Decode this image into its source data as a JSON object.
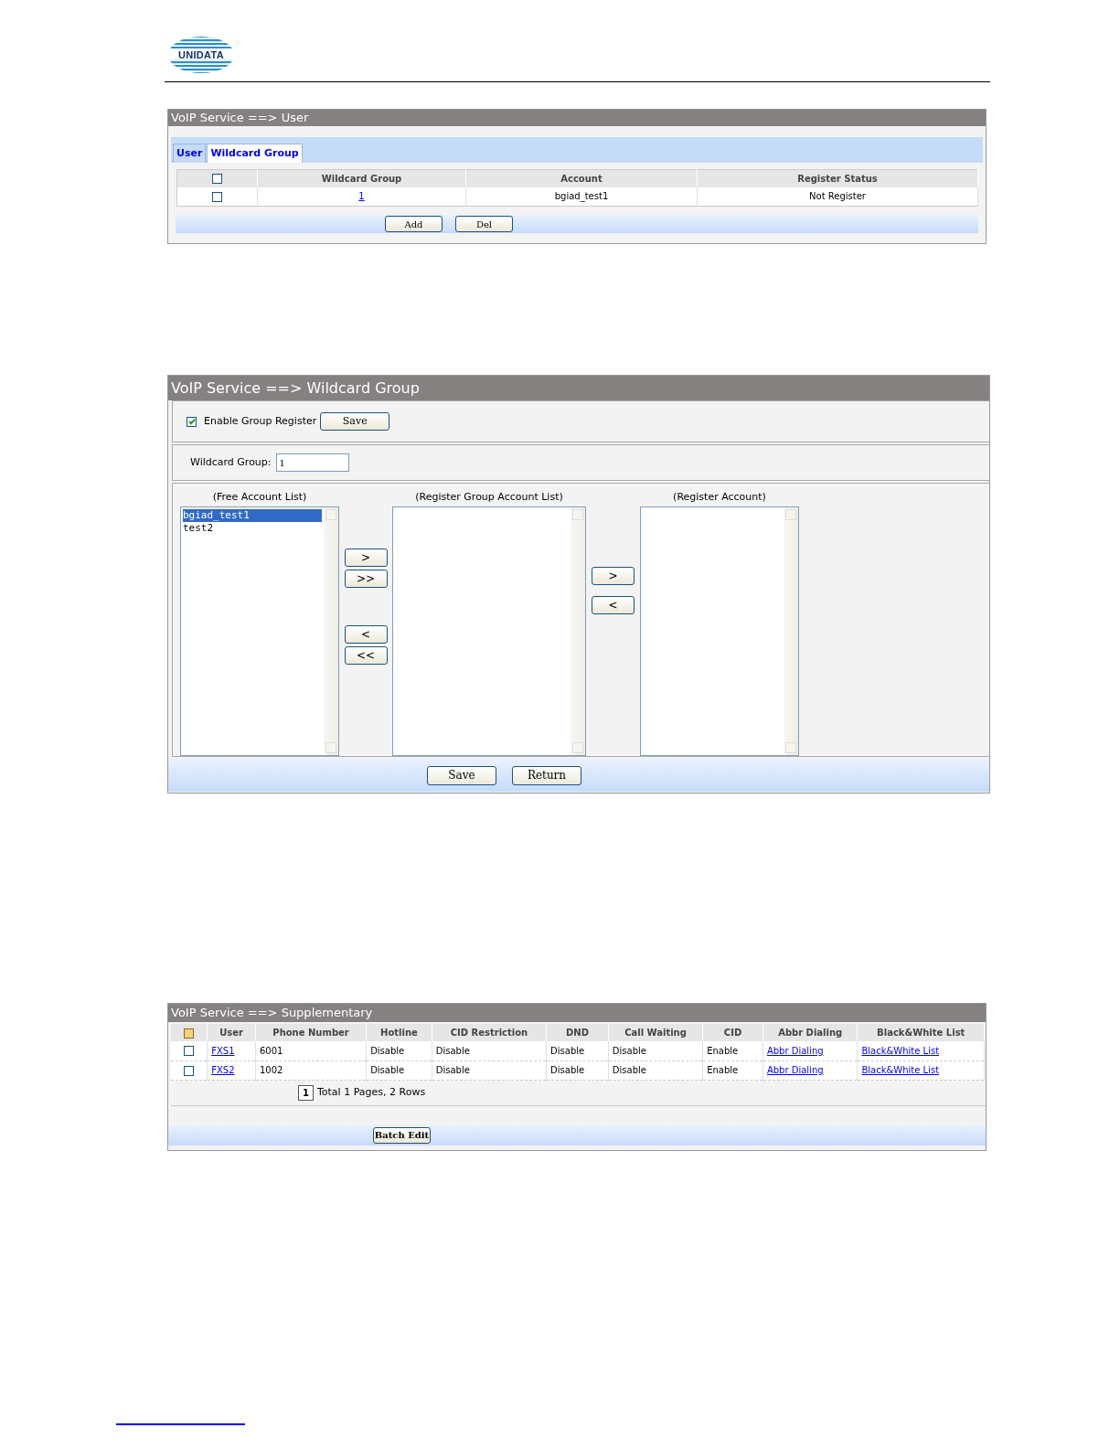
{
  "logo": "UNIDATA",
  "user_panel": {
    "title": "VoIP Service ==> User",
    "tabs": [
      {
        "label": "User",
        "selected": false
      },
      {
        "label": "Wildcard Group",
        "selected": true
      }
    ],
    "header_checked": false,
    "columns": [
      "Wildcard Group",
      "Account",
      "Register Status"
    ],
    "rows": [
      {
        "checked": false,
        "group": "1",
        "account": "bgiad_test1",
        "status": "Not Register"
      }
    ],
    "buttons": [
      "Add",
      "Del"
    ]
  },
  "wildcard_panel": {
    "title": "VoIP Service ==> Wildcard Group",
    "enable": {
      "label": "Enable Group Register",
      "checked": true
    },
    "enable_button": "Save",
    "group_label": "Wildcard Group:",
    "group_value": "1",
    "lists": [
      {
        "title": "(Free Account List)",
        "items": [
          {
            "label": "bgiad_test1",
            "selected": true
          },
          {
            "label": "test2",
            "selected": false
          }
        ]
      },
      {
        "title": "(Register Group Account List)"
      },
      {
        "title": "(Register Account)"
      }
    ],
    "left_moves": [
      ">",
      ">>",
      "<",
      "<<"
    ],
    "right_moves": [
      ">",
      "<"
    ],
    "buttons": [
      "Save",
      "Return"
    ]
  },
  "supplementary_panel": {
    "title": "VoIP Service ==> Supplementary",
    "header_checked": false,
    "columns": [
      "User",
      "Phone Number",
      "Hotline",
      "CID Restriction",
      "DND",
      "Call Waiting",
      "CID",
      "Abbr Dialing",
      "Black&White List"
    ],
    "rows": [
      {
        "checked": false,
        "cells": [
          "FXS1",
          "6001",
          "Disable",
          "Disable",
          "Disable",
          "Disable",
          "Enable",
          "Abbr Dialing",
          "Black&White List"
        ]
      },
      {
        "checked": false,
        "cells": [
          "FXS2",
          "1002",
          "Disable",
          "Disable",
          "Disable",
          "Disable",
          "Enable",
          "Abbr Dialing",
          "Black&White List"
        ]
      }
    ],
    "page": "1",
    "summary": "Total 1 Pages, 2 Rows",
    "button": "Batch Edit"
  }
}
